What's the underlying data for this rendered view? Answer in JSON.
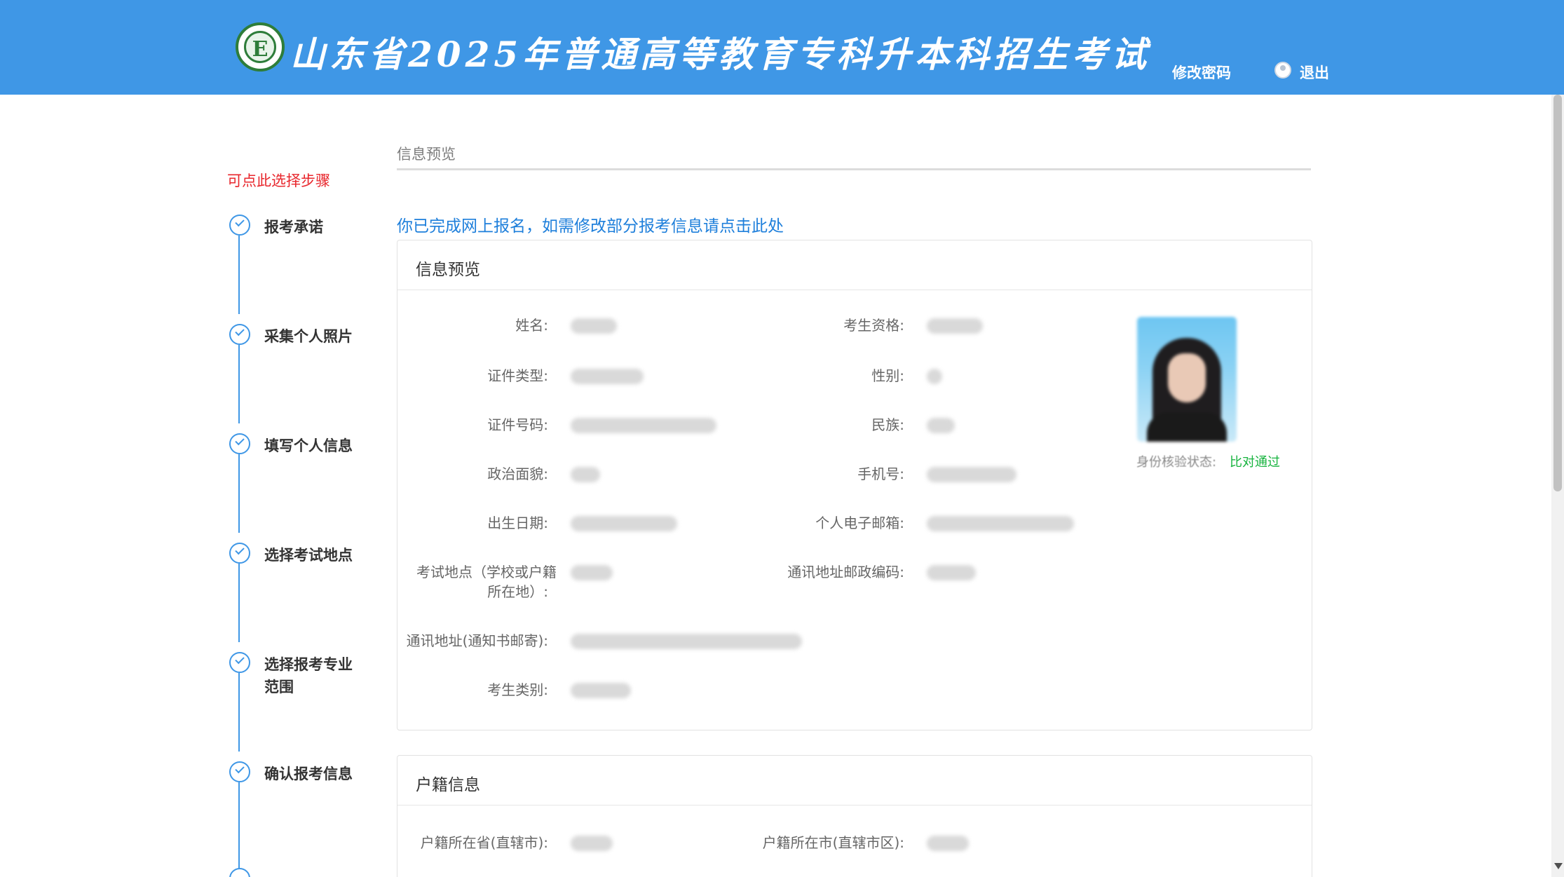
{
  "header": {
    "logo_letter": "E",
    "title": "山东省2025年普通高等教育专科升本科招生考试",
    "change_password": "修改密码",
    "logout": "退出"
  },
  "sidebar": {
    "hint": "可点此选择步骤",
    "steps": [
      {
        "label": "报考承诺",
        "status": "done"
      },
      {
        "label": "采集个人照片",
        "status": "done"
      },
      {
        "label": "填写个人信息",
        "status": "done"
      },
      {
        "label": "选择考试地点",
        "status": "done"
      },
      {
        "label": "选择报考专业范围",
        "status": "done"
      },
      {
        "label": "确认报考信息",
        "status": "done"
      }
    ]
  },
  "main": {
    "section_title": "信息预览",
    "notice": "你已完成网上报名，如需修改部分报考信息请点击此处",
    "info_panel": {
      "title": "信息预览",
      "fields": {
        "name": "姓名:",
        "qualification": "考生资格:",
        "id_type": "证件类型:",
        "gender": "性别:",
        "id_number": "证件号码:",
        "ethnicity": "民族:",
        "political_status": "政治面貌:",
        "phone": "手机号:",
        "birth_date": "出生日期:",
        "email": "个人电子邮箱:",
        "exam_location_line1": "考试地点（学校或户籍",
        "exam_location_line2": "所在地）:",
        "postal_code": "通讯地址邮政编码:",
        "mailing_address": "通讯地址(通知书邮寄):",
        "candidate_category": "考生类别:"
      },
      "id_verify_label": "身份核验状态:",
      "id_verify_value": "比对通过"
    },
    "household_panel": {
      "title": "户籍信息",
      "province_label": "户籍所在省(直辖市):",
      "city_label": "户籍所在市(直辖市区):"
    }
  },
  "colors": {
    "header_bg": "#3f97e6",
    "accent": "#3f97e6",
    "notice": "#1e7fdb",
    "hint": "#e8262c",
    "success": "#16b33e"
  }
}
